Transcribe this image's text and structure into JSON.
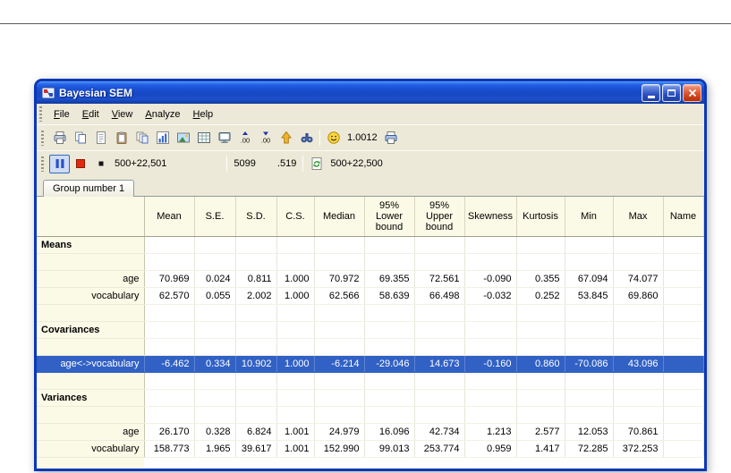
{
  "window": {
    "title": "Bayesian SEM",
    "menus": [
      {
        "label": "File"
      },
      {
        "label": "Edit"
      },
      {
        "label": "View"
      },
      {
        "label": "Analyze"
      },
      {
        "label": "Help"
      }
    ],
    "toolbar_main": [
      {
        "type": "icon",
        "name": "print-icon"
      },
      {
        "type": "icon",
        "name": "copy-icon"
      },
      {
        "type": "icon",
        "name": "page-icon"
      },
      {
        "type": "icon",
        "name": "clipboard-icon"
      },
      {
        "type": "icon",
        "name": "duplicate-icon"
      },
      {
        "type": "icon",
        "name": "histogram-icon"
      },
      {
        "type": "icon",
        "name": "image-icon"
      },
      {
        "type": "icon",
        "name": "grid-icon"
      },
      {
        "type": "icon",
        "name": "monitor-icon"
      },
      {
        "type": "icon",
        "name": "decimal-up-icon"
      },
      {
        "type": "icon",
        "name": "decimal-down-icon"
      },
      {
        "type": "icon",
        "name": "arrow-up-icon"
      },
      {
        "type": "icon",
        "name": "binoculars-icon"
      },
      {
        "type": "sep"
      },
      {
        "type": "icon",
        "name": "smiley-icon"
      },
      {
        "type": "label",
        "name": "convergence-statistic-value",
        "text": "1.0012"
      },
      {
        "type": "icon",
        "name": "posterior-print-icon"
      }
    ],
    "toolbar_mcmc": [
      {
        "type": "icon",
        "name": "pause-button",
        "pressed": true
      },
      {
        "type": "icon",
        "name": "stop-button"
      },
      {
        "type": "icon",
        "name": "step-button"
      },
      {
        "type": "label",
        "name": "burnin-plus-samples-label",
        "text": "500+22,501"
      },
      {
        "type": "spacer",
        "w": 60
      },
      {
        "type": "sep"
      },
      {
        "type": "label",
        "name": "distinct-samples-label",
        "text": "5099"
      },
      {
        "type": "spacer",
        "w": 16
      },
      {
        "type": "label",
        "name": "acceptance-ratio-label",
        "text": ".519"
      },
      {
        "type": "sep"
      },
      {
        "type": "icon",
        "name": "refresh-icon"
      },
      {
        "type": "label",
        "name": "burnin-plus-target-label",
        "text": "500+22,500"
      }
    ],
    "tab": "Group number 1"
  },
  "colors": {
    "selection": "#3161c4",
    "titlebar": "#1b52d6",
    "header_bg": "#fbfae6"
  },
  "table": {
    "columns": [
      "",
      "Mean",
      "S.E.",
      "S.D.",
      "C.S.",
      "Median",
      "95%\nLower\nbound",
      "95%\nUpper\nbound",
      "Skewness",
      "Kurtosis",
      "Min",
      "Max",
      "Name"
    ],
    "rows": [
      {
        "type": "section",
        "label": "Means"
      },
      {
        "type": "blank",
        "label": ""
      },
      {
        "type": "data",
        "label": "age",
        "values": [
          "70.969",
          "0.024",
          "0.811",
          "1.000",
          "70.972",
          "69.355",
          "72.561",
          "-0.090",
          "0.355",
          "67.094",
          "74.077"
        ]
      },
      {
        "type": "data",
        "label": "vocabulary",
        "values": [
          "62.570",
          "0.055",
          "2.002",
          "1.000",
          "62.566",
          "58.639",
          "66.498",
          "-0.032",
          "0.252",
          "53.845",
          "69.860"
        ]
      },
      {
        "type": "blank",
        "label": ""
      },
      {
        "type": "section",
        "label": "Covariances"
      },
      {
        "type": "blank",
        "label": ""
      },
      {
        "type": "data",
        "selected": true,
        "label": "age<->vocabulary",
        "values": [
          "-6.462",
          "0.334",
          "10.902",
          "1.000",
          "-6.214",
          "-29.046",
          "14.673",
          "-0.160",
          "0.860",
          "-70.086",
          "43.096"
        ]
      },
      {
        "type": "blank",
        "label": ""
      },
      {
        "type": "section",
        "label": "Variances"
      },
      {
        "type": "blank",
        "label": ""
      },
      {
        "type": "data",
        "label": "age",
        "values": [
          "26.170",
          "0.328",
          "6.824",
          "1.001",
          "24.979",
          "16.096",
          "42.734",
          "1.213",
          "2.577",
          "12.053",
          "70.861"
        ]
      },
      {
        "type": "data",
        "label": "vocabulary",
        "values": [
          "158.773",
          "1.965",
          "39.617",
          "1.001",
          "152.990",
          "99.013",
          "253.774",
          "0.959",
          "1.417",
          "72.285",
          "372.253"
        ]
      }
    ]
  }
}
